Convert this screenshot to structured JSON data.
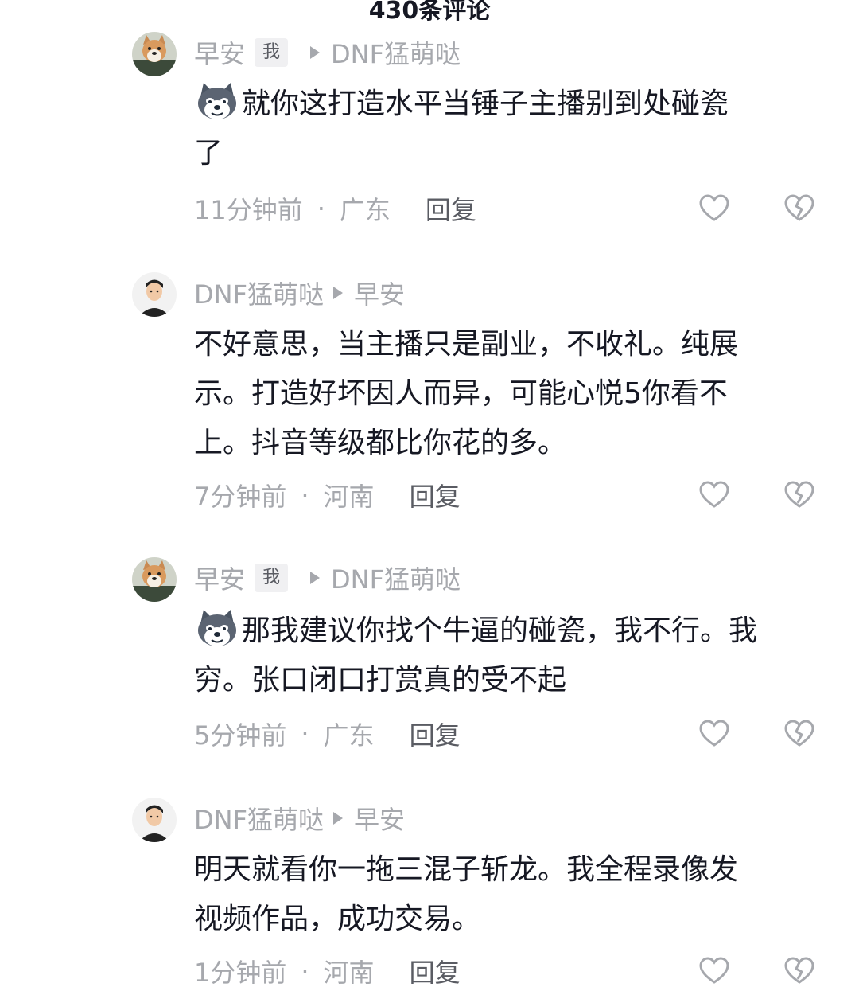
{
  "header": {
    "title": "430条评论"
  },
  "comments": [
    {
      "author": "早安",
      "me_badge": "我",
      "reply_to": "DNF猛萌哒",
      "text_line1": "就你这打造水平当锤子主播别到处碰瓷",
      "text_line2": "了",
      "time": "11分钟前",
      "region": "广东",
      "reply_label": "回复"
    },
    {
      "author": "DNF猛萌哒",
      "reply_to": "早安",
      "text_line1": "不好意思，当主播只是副业，不收礼。纯展",
      "text_line2": "示。打造好坏因人而异，可能心悦5你看不",
      "text_line3": "上。抖音等级都比你花的多。",
      "time": "7分钟前",
      "region": "河南",
      "reply_label": "回复"
    },
    {
      "author": "早安",
      "me_badge": "我",
      "reply_to": "DNF猛萌哒",
      "text_line1": "那我建议你找个牛逼的碰瓷，我不行。我",
      "text_line2": "穷。张口闭口打赏真的受不起",
      "time": "5分钟前",
      "region": "广东",
      "reply_label": "回复"
    },
    {
      "author": "DNF猛萌哒",
      "reply_to": "早安",
      "text_line1": "明天就看你一拖三混子斩龙。我全程录像发",
      "text_line2": "视频作品，成功交易。",
      "time": "1分钟前",
      "region": "河南",
      "reply_label": "回复"
    }
  ],
  "icons": {
    "like": "heart-outline-icon",
    "dislike": "broken-heart-icon",
    "emoji": "husky-dog-emoji"
  }
}
